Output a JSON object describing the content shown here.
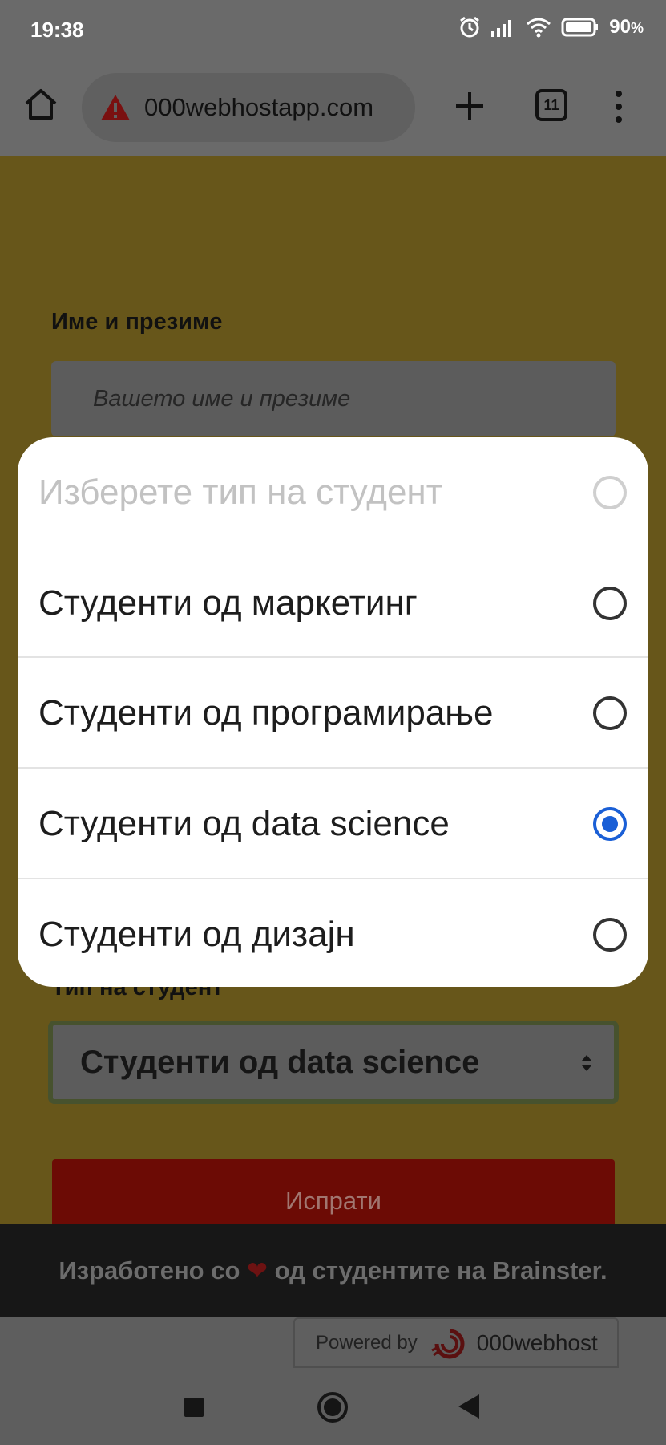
{
  "status_bar": {
    "time": "19:38",
    "battery": "90"
  },
  "browser": {
    "url": "000webhostapp.com",
    "tab_count": "11"
  },
  "form": {
    "name_label": "Име и презиме",
    "name_placeholder": "Вашето име и презиме",
    "type_label": "Тип на студент",
    "type_selected": "Студенти од data science",
    "submit_label": "Испрати"
  },
  "footer": {
    "text_before": "Изработено со",
    "text_after": "од студентите на Brainster."
  },
  "powered": {
    "label": "Powered by",
    "brand": "000webhost"
  },
  "dialog": {
    "options": [
      {
        "label": "Изберете тип на студент",
        "disabled": true,
        "checked": false
      },
      {
        "label": "Студенти од маркетинг",
        "disabled": false,
        "checked": false
      },
      {
        "label": "Студенти од програмирање",
        "disabled": false,
        "checked": false
      },
      {
        "label": "Студенти од data science",
        "disabled": false,
        "checked": true
      },
      {
        "label": "Студенти од дизајн",
        "disabled": false,
        "checked": false
      }
    ]
  },
  "colors": {
    "radio_checked": "#1a5fd6",
    "submit_bg": "#6c0b05"
  },
  "icons": [
    "home-icon",
    "warning-icon",
    "plus-icon",
    "tabs-icon",
    "more-vert-icon",
    "alarm-icon",
    "signal-icon",
    "wifi-icon",
    "battery-icon",
    "heart-icon",
    "recent-apps-icon",
    "home-nav-icon",
    "back-icon"
  ]
}
